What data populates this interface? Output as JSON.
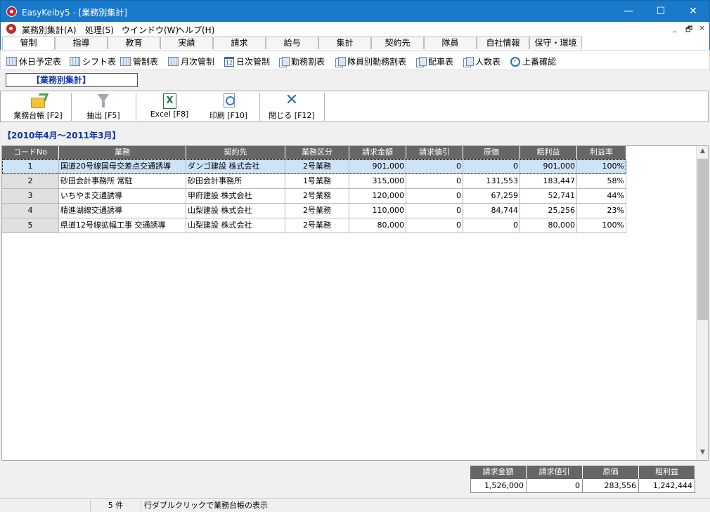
{
  "window": {
    "title": "EasyKeiby5 - [業務別集計]",
    "min_glyph": "—",
    "max_glyph": "☐",
    "close_glyph": "✕",
    "mdi_min": "_",
    "mdi_restore": "🗗",
    "mdi_close": "×"
  },
  "menu": {
    "items": [
      "業務別集計(A)",
      "処理(S)",
      "ウインドウ(W)",
      "ヘルプ(H)"
    ]
  },
  "category_tabs": [
    "管制",
    "指導",
    "教育",
    "実績",
    "請求",
    "給与",
    "集計",
    "契約先",
    "隊員",
    "自社情報",
    "保守・環境"
  ],
  "active_tab": "管制",
  "sub_toolbar": [
    {
      "label": "休日予定表",
      "icon": "grid-icon"
    },
    {
      "label": "シフト表",
      "icon": "grid-icon"
    },
    {
      "label": "管制表",
      "icon": "grid-icon"
    },
    {
      "label": "月次管制",
      "icon": "grid-icon"
    },
    {
      "label": "日次管制",
      "icon": "calendar-icon",
      "cal_num": "12"
    },
    {
      "label": "勤務割表",
      "icon": "document-icon"
    },
    {
      "label": "隊員別勤務割表",
      "icon": "document-icon"
    },
    {
      "label": "配車表",
      "icon": "document-icon"
    },
    {
      "label": "人数表",
      "icon": "document-icon"
    },
    {
      "label": "上番確認",
      "icon": "clock-icon"
    }
  ],
  "form_title": "【業務別集計】",
  "actions": {
    "ledger": "業務台帳 [F2]",
    "extract": "抽出 [F5]",
    "excel": "Excel [F8]",
    "print": "印刷 [F10]",
    "close": "閉じる [F12]"
  },
  "period": "【2010年4月～2011年3月】",
  "table": {
    "headers": [
      "コードNo",
      "業務",
      "契約先",
      "業務区分",
      "請求金額",
      "請求値引",
      "原価",
      "粗利益",
      "利益率"
    ],
    "rows": [
      [
        "1",
        "国道20号線国母交差点交通誘導",
        "ダンゴ建設 株式会社",
        "2号業務",
        "901,000",
        "0",
        "0",
        "901,000",
        "100%"
      ],
      [
        "2",
        "砂田会計事務所 常駐",
        "砂田会計事務所",
        "1号業務",
        "315,000",
        "0",
        "131,553",
        "183,447",
        "58%"
      ],
      [
        "3",
        "いちやま交通誘導",
        "甲府建設 株式会社",
        "2号業務",
        "120,000",
        "0",
        "67,259",
        "52,741",
        "44%"
      ],
      [
        "4",
        "精進湖線交通誘導",
        "山梨建設 株式会社",
        "2号業務",
        "110,000",
        "0",
        "84,744",
        "25,256",
        "23%"
      ],
      [
        "5",
        "県道12号線拡幅工事 交通誘導",
        "山梨建設 株式会社",
        "2号業務",
        "80,000",
        "0",
        "0",
        "80,000",
        "100%"
      ]
    ],
    "selected_row": 0
  },
  "scroll": {
    "up": "▲",
    "down": "▼"
  },
  "totals": {
    "headers": [
      "請求金額",
      "請求値引",
      "原価",
      "粗利益"
    ],
    "values": [
      "1,526,000",
      "0",
      "283,556",
      "1,242,444"
    ]
  },
  "status": {
    "count": "5 件",
    "hint": "行ダブルクリックで業務台帳の表示"
  }
}
